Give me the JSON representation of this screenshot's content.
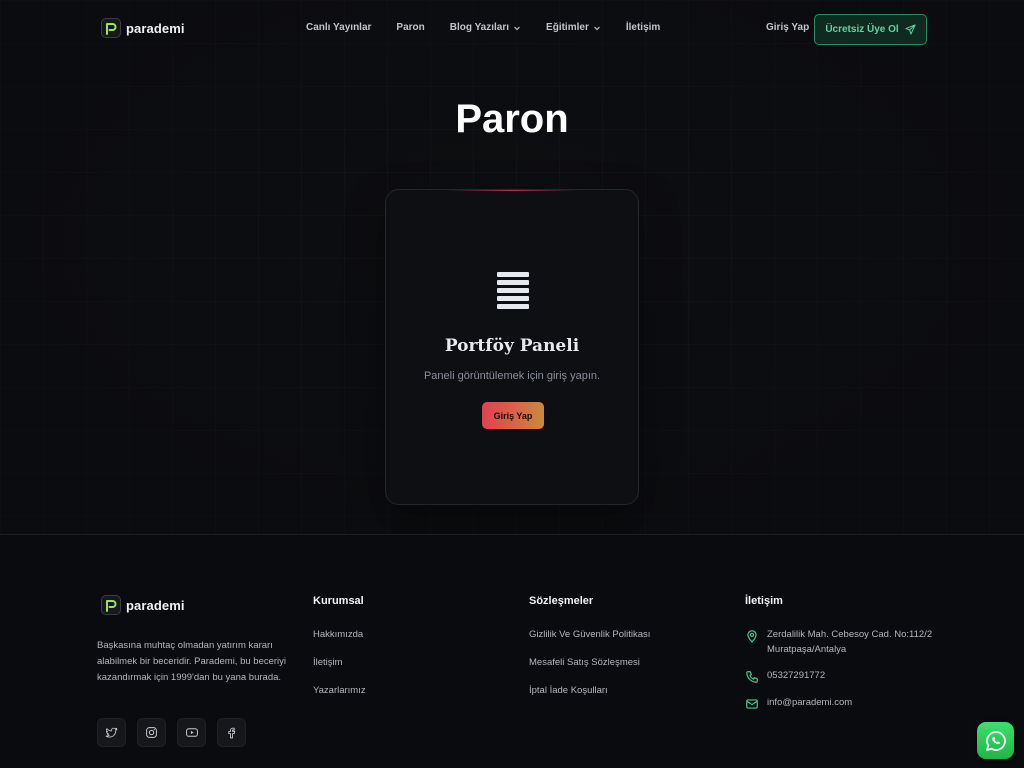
{
  "brand": {
    "name": "parademi"
  },
  "nav": {
    "items": [
      {
        "label": "Canlı Yayınlar",
        "has_dropdown": false
      },
      {
        "label": "Paron",
        "has_dropdown": false
      },
      {
        "label": "Blog Yazıları",
        "has_dropdown": true
      },
      {
        "label": "Eğitimler",
        "has_dropdown": true
      },
      {
        "label": "İletişim",
        "has_dropdown": false
      }
    ],
    "login_label": "Giriş Yap",
    "signup_label": "Ücretsiz Üye Ol"
  },
  "main": {
    "title": "Paron",
    "card": {
      "icon": "stacked-bars-icon",
      "title": "Portföy Paneli",
      "description": "Paneli görüntülemek için giriş yapın.",
      "button_label": "Giriş Yap"
    }
  },
  "footer": {
    "about": "Başkasına muhtaç olmadan yatırım kararı alabilmek bir beceridir. Parademi, bu beceriyi kazandırmak için 1999'dan bu yana burada.",
    "socials": [
      "twitter-icon",
      "instagram-icon",
      "youtube-icon",
      "facebook-icon"
    ],
    "columns": [
      {
        "title": "Kurumsal",
        "links": [
          "Hakkımızda",
          "İletişim",
          "Yazarlarımız"
        ]
      },
      {
        "title": "Sözleşmeler",
        "links": [
          "Gizlilik Ve Güvenlik Politikası",
          "Mesafeli Satış Sözleşmesi",
          "İptal İade Koşulları"
        ]
      }
    ],
    "contact": {
      "title": "İletişim",
      "address": "Zerdalilik Mah. Cebesoy Cad. No:112/2 Muratpaşa/Antalya",
      "phone": "05327291772",
      "email": "info@parademi.com"
    }
  },
  "colors": {
    "accent_green": "#5fd3a0",
    "button_gradient_start": "#e0414f",
    "button_gradient_end": "#c98a3c",
    "whatsapp_green": "#25d366"
  }
}
